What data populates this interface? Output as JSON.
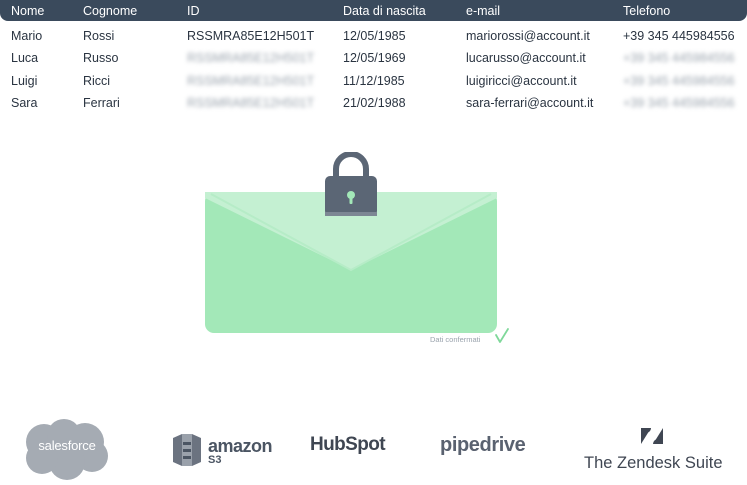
{
  "table": {
    "headers": [
      "Nome",
      "Cognome",
      "ID",
      "Data di nascita",
      "e-mail",
      "Telefono"
    ],
    "rows": [
      [
        "Mario",
        "Rossi",
        "RSSMRA85E12H501T",
        "12/05/1985",
        "mariorossi@account.it",
        "+39 345 445984556"
      ],
      [
        "Luca",
        "Russo",
        "RSSMRA85E12H501T",
        "12/05/1969",
        "lucarusso@account.it",
        "+39 345 445984556"
      ],
      [
        "Luigi",
        "Ricci",
        "RSSMRA85E12H501T",
        "11/12/1985",
        "luigiricci@account.it",
        "+39 345 445984556"
      ],
      [
        "Sara",
        "Ferrari",
        "RSSMRA85E12H501T",
        "21/02/1988",
        "sara-ferrari@account.it",
        "+39 345 445984556"
      ]
    ],
    "blurred_cells": [
      [
        1,
        2
      ],
      [
        1,
        5
      ],
      [
        2,
        2
      ],
      [
        2,
        5
      ],
      [
        3,
        2
      ],
      [
        3,
        5
      ]
    ]
  },
  "illustration": {
    "confirm_text": "Dati confermati",
    "envelope_color": "#a3e8b8",
    "lock_color": "#5b6675",
    "check_color": "#7fd89a"
  },
  "logos": {
    "salesforce": "salesforce",
    "amazon_word": "amazon",
    "amazon_sub": "S3",
    "hubspot": "HubSpot",
    "pipedrive": "pipedrive",
    "zendesk": "The Zendesk Suite"
  },
  "colors": {
    "header_bg": "#3a4a5c",
    "salesforce_cloud": "#a5abb3"
  }
}
